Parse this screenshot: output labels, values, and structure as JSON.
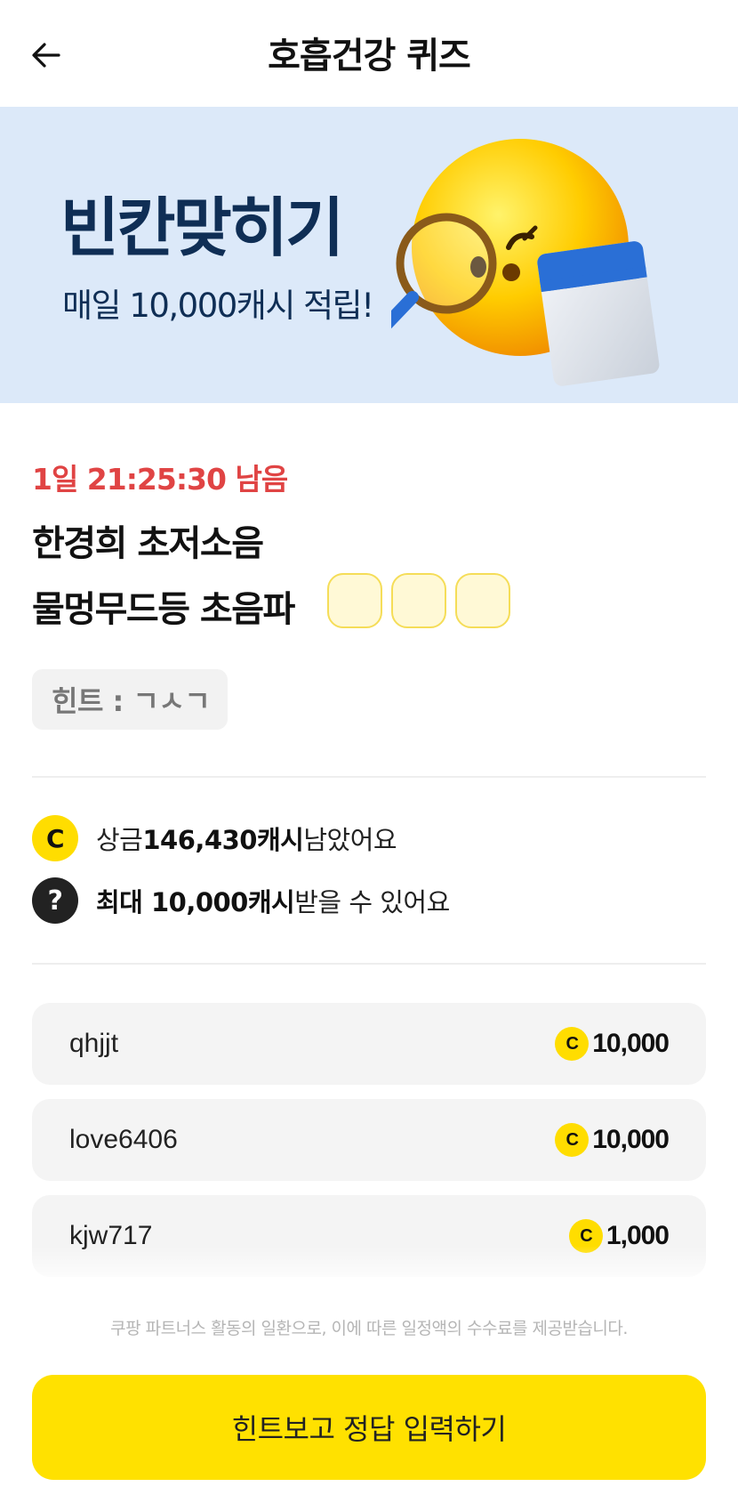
{
  "header": {
    "title": "호흡건강 퀴즈"
  },
  "banner": {
    "title": "빈칸맞히기",
    "subtitle": "매일 10,000캐시 적립!"
  },
  "quiz": {
    "timer": "1일 21:25:30 남음",
    "question_line1": "한경희 초저소음",
    "question_line2": "물멍무드등 초음파",
    "blank_count": 3,
    "hint": "힌트 : ㄱㅅㄱ"
  },
  "info": {
    "prize_prefix": "상금 ",
    "prize_amount": "146,430캐시",
    "prize_suffix": " 남았어요",
    "max_amount": "최대 10,000캐시",
    "max_suffix": " 받을 수 있어요",
    "coin_icon": "C",
    "question_icon": "?"
  },
  "leaderboard": [
    {
      "name": "qhjjt",
      "amount": "10,000"
    },
    {
      "name": "love6406",
      "amount": "10,000"
    },
    {
      "name": "kjw717",
      "amount": "1,000"
    }
  ],
  "disclaimer": "쿠팡 파트너스 활동의 일환으로, 이에 따른 일정액의 수수료를 제공받습니다.",
  "cta": {
    "label": "힌트보고 정답 입력하기"
  },
  "colors": {
    "accent_yellow": "#ffe100",
    "timer_red": "#e04444",
    "banner_bg": "#dce9f9",
    "banner_text": "#0f2e55"
  }
}
